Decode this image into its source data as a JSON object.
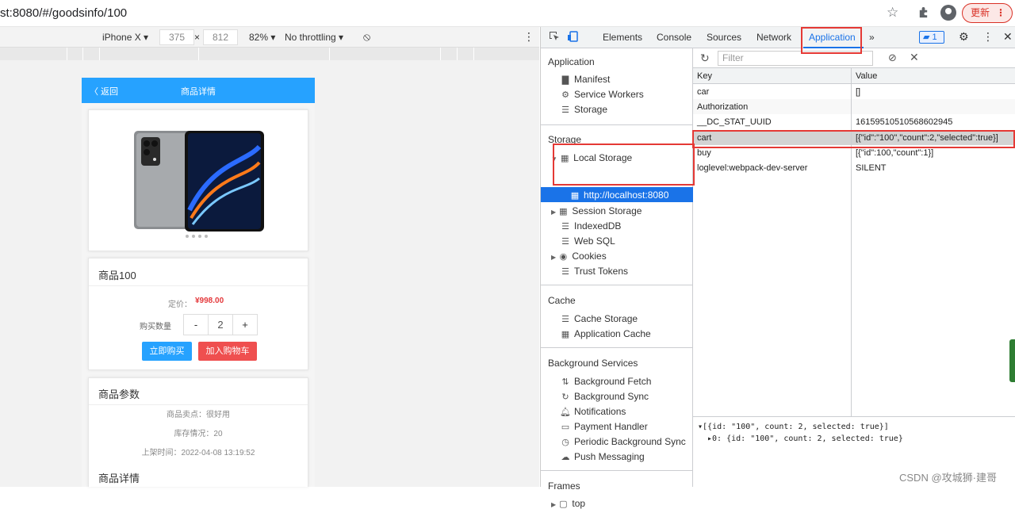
{
  "browser": {
    "url": "st:8080/#/goodsinfo/100",
    "update_label": "更新"
  },
  "device_toolbar": {
    "device": "iPhone X ▾",
    "width": "375",
    "times": "×",
    "height": "812",
    "zoom": "82% ▾",
    "throttle": "No throttling ▾"
  },
  "page": {
    "back": "〈 返回",
    "title": "商品详情",
    "product_name": "商品100",
    "price_label": "定价：",
    "price": "¥998.00",
    "qty_label": "购买数量",
    "qty_minus": "-",
    "qty_value": "2",
    "qty_plus": "+",
    "buy_button": "立即购买",
    "cart_button": "加入购物车",
    "params_heading": "商品参数",
    "params": [
      "商品卖点：很好用",
      "库存情况：20",
      "上架时间：2022-04-08 13:19:52"
    ],
    "detail_heading": "商品详情"
  },
  "devtools": {
    "tabs": [
      "Elements",
      "Console",
      "Sources",
      "Network",
      "Application",
      "»"
    ],
    "active_tab": "Application",
    "issues_count": "1",
    "filter_placeholder": "Filter",
    "sidebar": {
      "application_heading": "Application",
      "application_items": [
        "Manifest",
        "Service Workers",
        "Storage"
      ],
      "storage_heading": "Storage",
      "local_storage": "Local Storage",
      "local_storage_origin": "http://localhost:8080",
      "storage_items": [
        "Session Storage",
        "IndexedDB",
        "Web SQL",
        "Cookies",
        "Trust Tokens"
      ],
      "cache_heading": "Cache",
      "cache_items": [
        "Cache Storage",
        "Application Cache"
      ],
      "bg_heading": "Background Services",
      "bg_items": [
        "Background Fetch",
        "Background Sync",
        "Notifications",
        "Payment Handler",
        "Periodic Background Sync",
        "Push Messaging"
      ],
      "frames_heading": "Frames",
      "frames_top": "top"
    },
    "table": {
      "key_header": "Key",
      "value_header": "Value",
      "rows": [
        {
          "key": "car",
          "value": "[]"
        },
        {
          "key": "Authorization",
          "value": ""
        },
        {
          "key": "__DC_STAT_UUID",
          "value": "16159510510568602945"
        },
        {
          "key": "cart",
          "value": "[{\"id\":\"100\",\"count\":2,\"selected\":true}]"
        },
        {
          "key": "buy",
          "value": "[{\"id\":100,\"count\":1}]"
        },
        {
          "key": "loglevel:webpack-dev-server",
          "value": "SILENT"
        }
      ]
    },
    "preview": {
      "line1": "[{id: \"100\", count: 2, selected: true}]",
      "line2": "0: {id: \"100\", count: 2, selected: true}"
    }
  },
  "watermark": "CSDN @攻城狮·建哥",
  "colors": {
    "accent_blue": "#26a2ff",
    "cart_red": "#ef4f4f",
    "devtools_blue": "#1a73e8",
    "highlight_red": "#e53935"
  }
}
